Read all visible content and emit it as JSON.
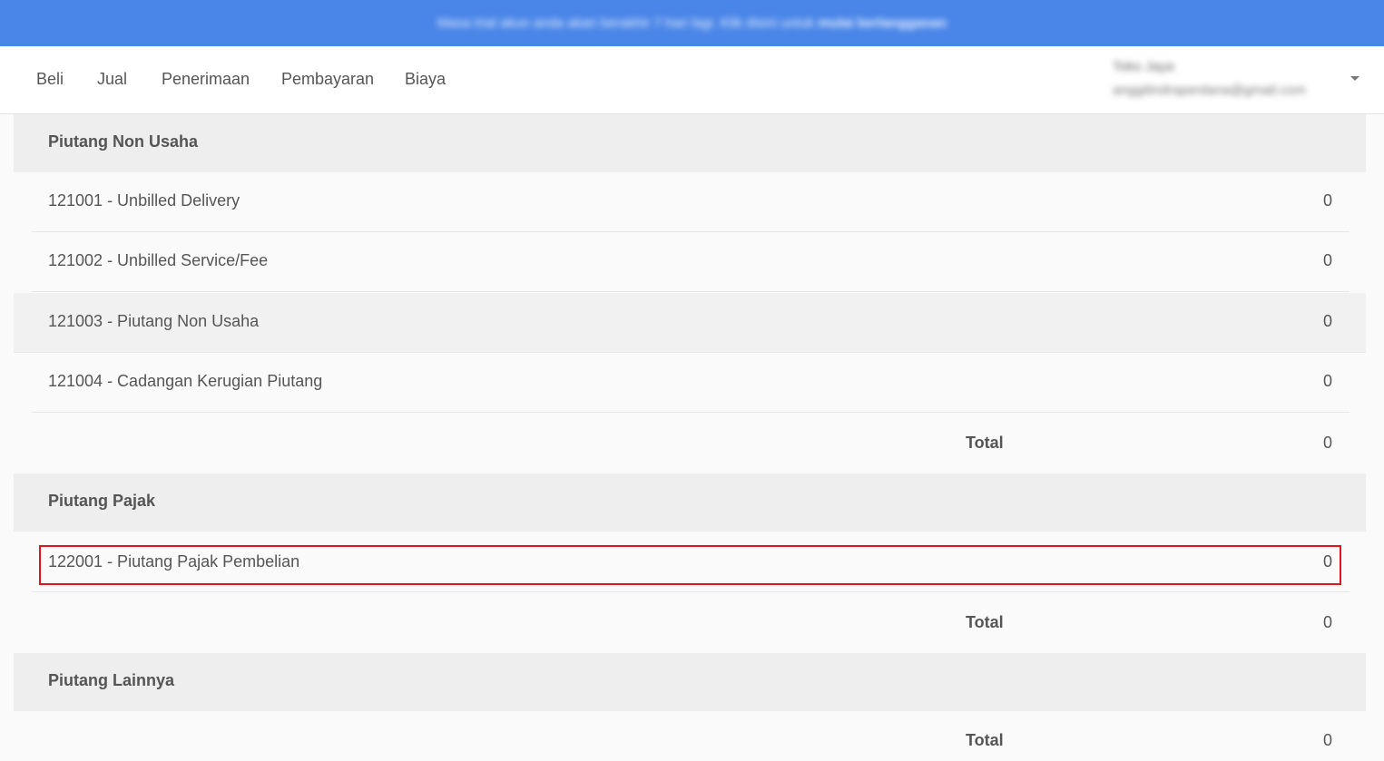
{
  "banner": {
    "message": "Masa trial akun anda akan berakhir 7 hari lagi. Klik disini untuk",
    "link": "mulai berlangganan"
  },
  "nav": {
    "items": [
      "Beli",
      "Jual",
      "Penerimaan",
      "Pembayaran",
      "Biaya"
    ]
  },
  "user": {
    "name": "Toko Jaya",
    "email": "anggitindraperdana@gmail.com"
  },
  "sections": [
    {
      "title": "Piutang Non Usaha",
      "rows": [
        {
          "label": "121001 - Unbilled Delivery",
          "value": "0"
        },
        {
          "label": "121002 - Unbilled Service/Fee",
          "value": "0"
        },
        {
          "label": "121003 - Piutang Non Usaha",
          "value": "0"
        },
        {
          "label": "121004 - Cadangan Kerugian Piutang",
          "value": "0"
        }
      ],
      "total_label": "Total",
      "total_value": "0"
    },
    {
      "title": "Piutang Pajak",
      "rows": [
        {
          "label": "122001 - Piutang Pajak Pembelian",
          "value": "0"
        }
      ],
      "total_label": "Total",
      "total_value": "0"
    },
    {
      "title": "Piutang Lainnya",
      "rows": [],
      "total_label": "Total",
      "total_value": "0"
    }
  ],
  "colors": {
    "banner": "#4a86e8",
    "highlight": "#e0141e"
  }
}
